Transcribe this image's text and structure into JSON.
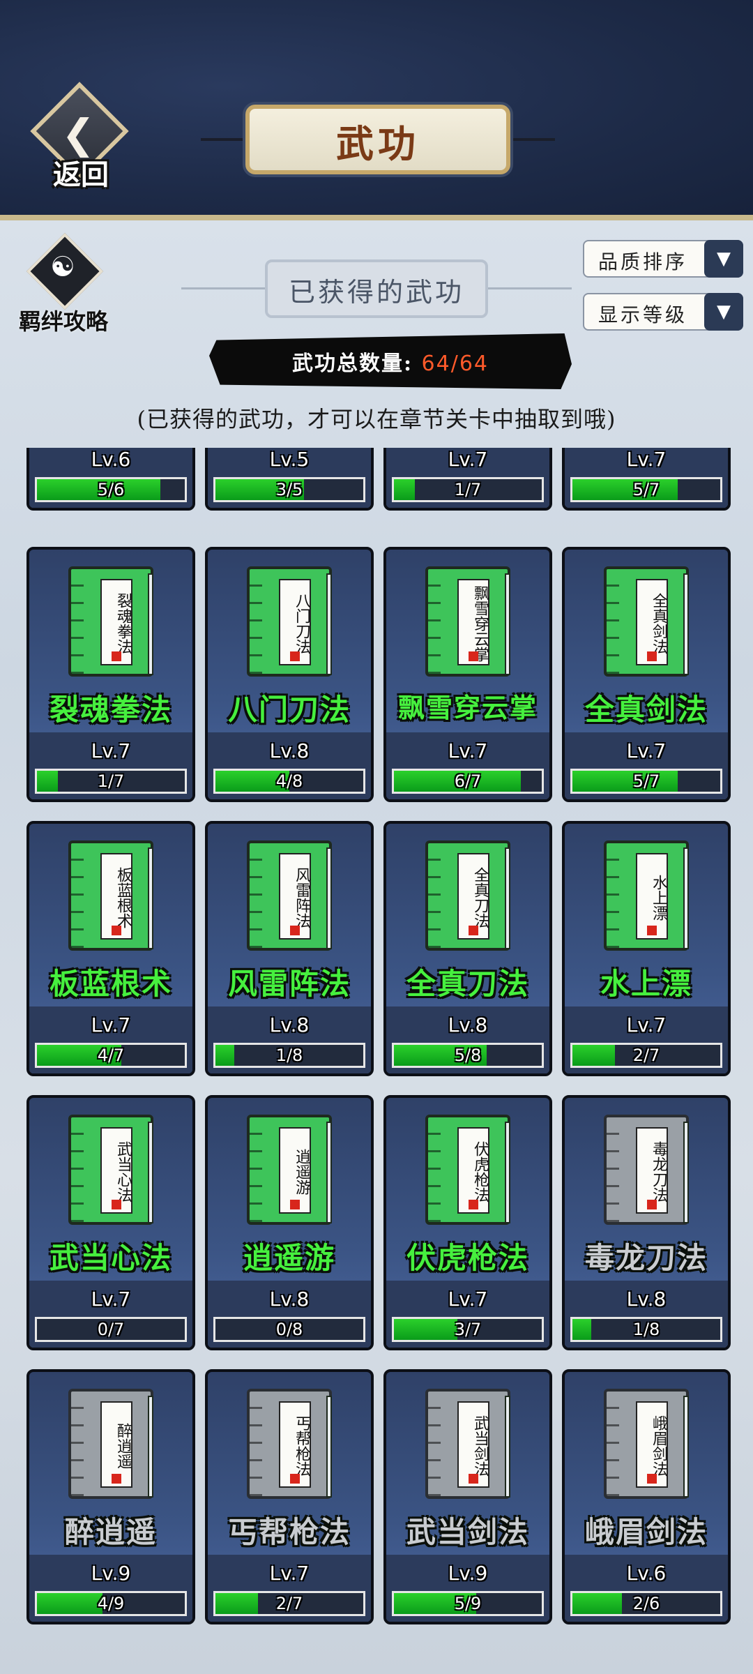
{
  "header": {
    "title": "武功",
    "back_label": "返回"
  },
  "bond_button": {
    "label": "羁绊攻略"
  },
  "section": {
    "title": "已获得的武功"
  },
  "sort_dropdown": {
    "label": "品质排序"
  },
  "level_dropdown": {
    "label": "显示等级"
  },
  "count": {
    "label": "武功总数量:",
    "value": "64/64"
  },
  "hint": "(已获得的武功，才可以在章节关卡中抽取到哦)",
  "top_row_partial": [
    {
      "level": "Lv.6",
      "progress": "5/6",
      "fraction": 0.8333
    },
    {
      "level": "Lv.5",
      "progress": "3/5",
      "fraction": 0.6
    },
    {
      "level": "Lv.7",
      "progress": "1/7",
      "fraction": 0.1429
    },
    {
      "level": "Lv.7",
      "progress": "5/7",
      "fraction": 0.7143
    }
  ],
  "cards": [
    {
      "name": "裂魂拳法",
      "book_text": "裂魂拳法",
      "quality": "green",
      "level": "Lv.7",
      "progress": "1/7",
      "fraction": 0.1429
    },
    {
      "name": "八门刀法",
      "book_text": "八门刀法",
      "quality": "green",
      "level": "Lv.8",
      "progress": "4/8",
      "fraction": 0.5
    },
    {
      "name": "飘雪穿云掌",
      "book_text": "飘雪穿云掌",
      "quality": "green",
      "level": "Lv.7",
      "progress": "6/7",
      "fraction": 0.8571
    },
    {
      "name": "全真剑法",
      "book_text": "全真剑法",
      "quality": "green",
      "level": "Lv.7",
      "progress": "5/7",
      "fraction": 0.7143
    },
    {
      "name": "板蓝根术",
      "book_text": "板蓝根术",
      "quality": "green",
      "level": "Lv.7",
      "progress": "4/7",
      "fraction": 0.5714
    },
    {
      "name": "风雷阵法",
      "book_text": "风雷阵法",
      "quality": "green",
      "level": "Lv.8",
      "progress": "1/8",
      "fraction": 0.125
    },
    {
      "name": "全真刀法",
      "book_text": "全真刀法",
      "quality": "green",
      "level": "Lv.8",
      "progress": "5/8",
      "fraction": 0.625
    },
    {
      "name": "水上漂",
      "book_text": "水上漂",
      "quality": "green",
      "level": "Lv.7",
      "progress": "2/7",
      "fraction": 0.2857
    },
    {
      "name": "武当心法",
      "book_text": "武当心法",
      "quality": "green",
      "level": "Lv.7",
      "progress": "0/7",
      "fraction": 0
    },
    {
      "name": "逍遥游",
      "book_text": "逍遥游",
      "quality": "green",
      "level": "Lv.8",
      "progress": "0/8",
      "fraction": 0
    },
    {
      "name": "伏虎枪法",
      "book_text": "伏虎枪法",
      "quality": "green",
      "level": "Lv.7",
      "progress": "3/7",
      "fraction": 0.4286
    },
    {
      "name": "毒龙刀法",
      "book_text": "毒龙刀法",
      "quality": "gray",
      "level": "Lv.8",
      "progress": "1/8",
      "fraction": 0.125
    },
    {
      "name": "醉逍遥",
      "book_text": "醉逍遥",
      "quality": "gray",
      "level": "Lv.9",
      "progress": "4/9",
      "fraction": 0.4444
    },
    {
      "name": "丐帮枪法",
      "book_text": "丐帮枪法",
      "quality": "gray",
      "level": "Lv.7",
      "progress": "2/7",
      "fraction": 0.2857
    },
    {
      "name": "武当剑法",
      "book_text": "武当剑法",
      "quality": "gray",
      "level": "Lv.9",
      "progress": "5/9",
      "fraction": 0.5556
    },
    {
      "name": "峨眉剑法",
      "book_text": "峨眉剑法",
      "quality": "gray",
      "level": "Lv.6",
      "progress": "2/6",
      "fraction": 0.3333
    }
  ]
}
